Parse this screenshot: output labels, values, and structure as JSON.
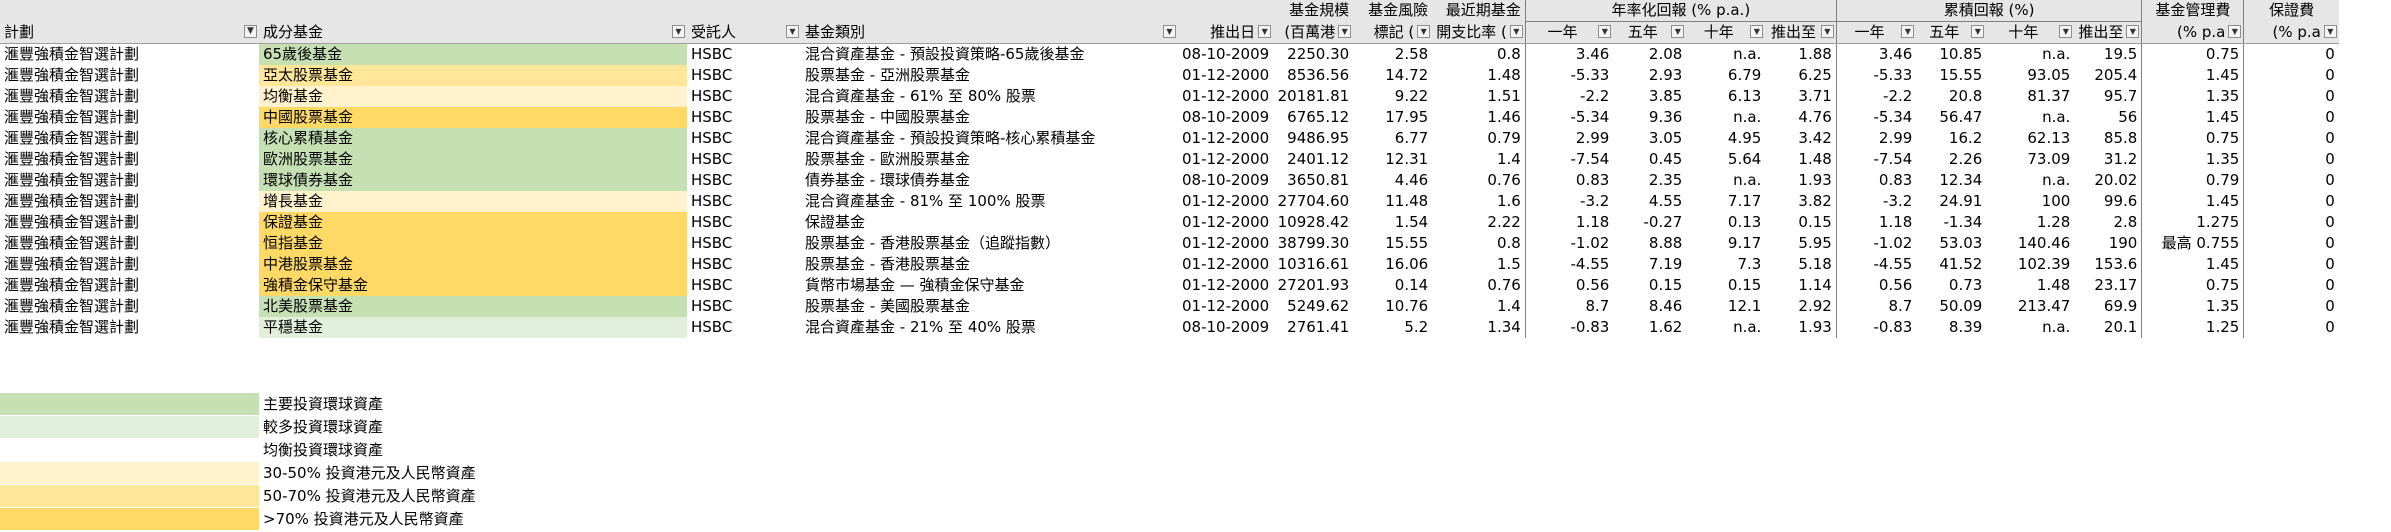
{
  "header": {
    "top": {
      "fund_size": "基金規模",
      "risk": "基金風險",
      "expense": "最近期基金",
      "annualized": "年率化回報 (% p.a.)",
      "cumulative": "累積回報 (%)",
      "mgmt_fee": "基金管理費",
      "guarantee_fee": "保證費"
    },
    "columns": {
      "scheme": "計劃",
      "fund": "成分基金",
      "trustee": "受託人",
      "category": "基金類別",
      "launch": "推出日",
      "size": "(百萬港",
      "risk": "標記 (",
      "expense": "開支比率 (",
      "ann_1y": "一年",
      "ann_5y": "五年",
      "ann_10y": "十年",
      "ann_since": "推出至",
      "cum_1y": "一年",
      "cum_5y": "五年",
      "cum_10y": "十年",
      "cum_since": "推出至",
      "fee": "(% p.a",
      "gfee": "(% p.a"
    }
  },
  "rows": [
    {
      "scheme": "滙豐強積金智選計劃",
      "fund": "65歲後基金",
      "color": "green1",
      "trustee": "HSBC",
      "category": "混合資產基金 - 預設投資策略-65歲後基金",
      "launch": "08-10-2009",
      "size": "2250.30",
      "risk": "2.58",
      "expense": "0.8",
      "a1": "3.46",
      "a5": "2.08",
      "a10": "n.a.",
      "as": "1.88",
      "c1": "3.46",
      "c5": "10.85",
      "c10": "n.a.",
      "cs": "19.5",
      "fee": "0.75",
      "gfee": "0"
    },
    {
      "scheme": "滙豐強積金智選計劃",
      "fund": "亞太股票基金",
      "color": "yellow2",
      "trustee": "HSBC",
      "category": "股票基金 - 亞洲股票基金",
      "launch": "01-12-2000",
      "size": "8536.56",
      "risk": "14.72",
      "expense": "1.48",
      "a1": "-5.33",
      "a5": "2.93",
      "a10": "6.79",
      "as": "6.25",
      "c1": "-5.33",
      "c5": "15.55",
      "c10": "93.05",
      "cs": "205.4",
      "fee": "1.45",
      "gfee": "0"
    },
    {
      "scheme": "滙豐強積金智選計劃",
      "fund": "均衡基金",
      "color": "yellow1",
      "trustee": "HSBC",
      "category": "混合資產基金 - 61% 至 80% 股票",
      "launch": "01-12-2000",
      "size": "20181.81",
      "risk": "9.22",
      "expense": "1.51",
      "a1": "-2.2",
      "a5": "3.85",
      "a10": "6.13",
      "as": "3.71",
      "c1": "-2.2",
      "c5": "20.8",
      "c10": "81.37",
      "cs": "95.7",
      "fee": "1.35",
      "gfee": "0"
    },
    {
      "scheme": "滙豐強積金智選計劃",
      "fund": "中國股票基金",
      "color": "yellow3",
      "trustee": "HSBC",
      "category": "股票基金 - 中國股票基金",
      "launch": "08-10-2009",
      "size": "6765.12",
      "risk": "17.95",
      "expense": "1.46",
      "a1": "-5.34",
      "a5": "9.36",
      "a10": "n.a.",
      "as": "4.76",
      "c1": "-5.34",
      "c5": "56.47",
      "c10": "n.a.",
      "cs": "56",
      "fee": "1.45",
      "gfee": "0"
    },
    {
      "scheme": "滙豐強積金智選計劃",
      "fund": "核心累積基金",
      "color": "green1",
      "trustee": "HSBC",
      "category": "混合資產基金 - 預設投資策略-核心累積基金",
      "launch": "01-12-2000",
      "size": "9486.95",
      "risk": "6.77",
      "expense": "0.79",
      "a1": "2.99",
      "a5": "3.05",
      "a10": "4.95",
      "as": "3.42",
      "c1": "2.99",
      "c5": "16.2",
      "c10": "62.13",
      "cs": "85.8",
      "fee": "0.75",
      "gfee": "0"
    },
    {
      "scheme": "滙豐強積金智選計劃",
      "fund": "歐洲股票基金",
      "color": "green1",
      "trustee": "HSBC",
      "category": "股票基金 - 歐洲股票基金",
      "launch": "01-12-2000",
      "size": "2401.12",
      "risk": "12.31",
      "expense": "1.4",
      "a1": "-7.54",
      "a5": "0.45",
      "a10": "5.64",
      "as": "1.48",
      "c1": "-7.54",
      "c5": "2.26",
      "c10": "73.09",
      "cs": "31.2",
      "fee": "1.35",
      "gfee": "0"
    },
    {
      "scheme": "滙豐強積金智選計劃",
      "fund": "環球債券基金",
      "color": "green1",
      "trustee": "HSBC",
      "category": "債券基金 - 環球債券基金",
      "launch": "08-10-2009",
      "size": "3650.81",
      "risk": "4.46",
      "expense": "0.76",
      "a1": "0.83",
      "a5": "2.35",
      "a10": "n.a.",
      "as": "1.93",
      "c1": "0.83",
      "c5": "12.34",
      "c10": "n.a.",
      "cs": "20.02",
      "fee": "0.79",
      "gfee": "0"
    },
    {
      "scheme": "滙豐強積金智選計劃",
      "fund": "增長基金",
      "color": "yellow1",
      "trustee": "HSBC",
      "category": "混合資產基金 - 81% 至 100% 股票",
      "launch": "01-12-2000",
      "size": "27704.60",
      "risk": "11.48",
      "expense": "1.6",
      "a1": "-3.2",
      "a5": "4.55",
      "a10": "7.17",
      "as": "3.82",
      "c1": "-3.2",
      "c5": "24.91",
      "c10": "100",
      "cs": "99.6",
      "fee": "1.45",
      "gfee": "0"
    },
    {
      "scheme": "滙豐強積金智選計劃",
      "fund": "保證基金",
      "color": "yellow3",
      "trustee": "HSBC",
      "category": "保證基金",
      "launch": "01-12-2000",
      "size": "10928.42",
      "risk": "1.54",
      "expense": "2.22",
      "a1": "1.18",
      "a5": "-0.27",
      "a10": "0.13",
      "as": "0.15",
      "c1": "1.18",
      "c5": "-1.34",
      "c10": "1.28",
      "cs": "2.8",
      "fee": "1.275",
      "gfee": "0"
    },
    {
      "scheme": "滙豐強積金智選計劃",
      "fund": "恒指基金",
      "color": "yellow3",
      "trustee": "HSBC",
      "category": "股票基金 - 香港股票基金（追蹤指數）",
      "launch": "01-12-2000",
      "size": "38799.30",
      "risk": "15.55",
      "expense": "0.8",
      "a1": "-1.02",
      "a5": "8.88",
      "a10": "9.17",
      "as": "5.95",
      "c1": "-1.02",
      "c5": "53.03",
      "c10": "140.46",
      "cs": "190",
      "fee": "最高 0.755",
      "gfee": "0"
    },
    {
      "scheme": "滙豐強積金智選計劃",
      "fund": "中港股票基金",
      "color": "yellow3",
      "trustee": "HSBC",
      "category": "股票基金 - 香港股票基金",
      "launch": "01-12-2000",
      "size": "10316.61",
      "risk": "16.06",
      "expense": "1.5",
      "a1": "-4.55",
      "a5": "7.19",
      "a10": "7.3",
      "as": "5.18",
      "c1": "-4.55",
      "c5": "41.52",
      "c10": "102.39",
      "cs": "153.6",
      "fee": "1.45",
      "gfee": "0"
    },
    {
      "scheme": "滙豐強積金智選計劃",
      "fund": "強積金保守基金",
      "color": "yellow3",
      "trustee": "HSBC",
      "category": "貨幣市場基金 — 強積金保守基金",
      "launch": "01-12-2000",
      "size": "27201.93",
      "risk": "0.14",
      "expense": "0.76",
      "a1": "0.56",
      "a5": "0.15",
      "a10": "0.15",
      "as": "1.14",
      "c1": "0.56",
      "c5": "0.73",
      "c10": "1.48",
      "cs": "23.17",
      "fee": "0.75",
      "gfee": "0"
    },
    {
      "scheme": "滙豐強積金智選計劃",
      "fund": "北美股票基金",
      "color": "green1",
      "trustee": "HSBC",
      "category": "股票基金 - 美國股票基金",
      "launch": "01-12-2000",
      "size": "5249.62",
      "risk": "10.76",
      "expense": "1.4",
      "a1": "8.7",
      "a5": "8.46",
      "a10": "12.1",
      "as": "2.92",
      "c1": "8.7",
      "c5": "50.09",
      "c10": "213.47",
      "cs": "69.9",
      "fee": "1.35",
      "gfee": "0"
    },
    {
      "scheme": "滙豐強積金智選計劃",
      "fund": "平穩基金",
      "color": "green2",
      "trustee": "HSBC",
      "category": "混合資產基金 - 21% 至 40% 股票",
      "launch": "08-10-2009",
      "size": "2761.41",
      "risk": "5.2",
      "expense": "1.34",
      "a1": "-0.83",
      "a5": "1.62",
      "a10": "n.a.",
      "as": "1.93",
      "c1": "-0.83",
      "c5": "8.39",
      "c10": "n.a.",
      "cs": "20.1",
      "fee": "1.25",
      "gfee": "0"
    }
  ],
  "legend": [
    {
      "color": "green1",
      "label": "主要投資環球資產"
    },
    {
      "color": "green2",
      "label": "較多投資環球資產"
    },
    {
      "color": "white",
      "label": "均衡投資環球資產"
    },
    {
      "color": "yellow1",
      "label": "30-50% 投資港元及人民幣資產"
    },
    {
      "color": "yellow2",
      "label": "50-70% 投資港元及人民幣資產"
    },
    {
      "color": "yellow3",
      "label": ">70% 投資港元及人民幣資產"
    }
  ],
  "colors": {
    "green1": "#c6e0b4",
    "green2": "#e2efda",
    "white": "#ffffff",
    "yellow1": "#fff2cc",
    "yellow2": "#ffe699",
    "yellow3": "#ffd966",
    "header": "#e7e6e6"
  }
}
